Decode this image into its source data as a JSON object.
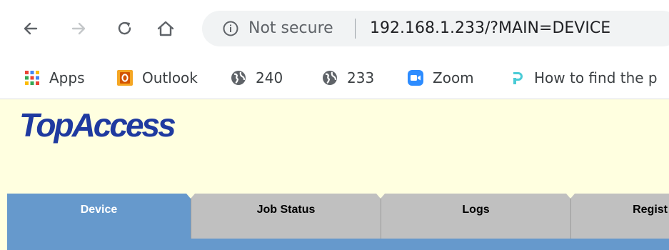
{
  "browser": {
    "security_label": "Not secure",
    "url": "192.168.1.233/?MAIN=DEVICE"
  },
  "bookmarks": [
    {
      "label": "Apps",
      "icon": "apps-grid-icon"
    },
    {
      "label": "Outlook",
      "icon": "outlook-icon"
    },
    {
      "label": "240",
      "icon": "globe-icon"
    },
    {
      "label": "233",
      "icon": "globe-icon"
    },
    {
      "label": "Zoom",
      "icon": "zoom-icon"
    },
    {
      "label": "How to find the p",
      "icon": "tplink-icon"
    }
  ],
  "app": {
    "logo_text": "TopAccess",
    "tabs": [
      {
        "label": "Device",
        "active": true
      },
      {
        "label": "Job Status",
        "active": false
      },
      {
        "label": "Logs",
        "active": false
      },
      {
        "label": "Regist",
        "active": false
      }
    ]
  },
  "colors": {
    "page_background": "#ffffe0",
    "active_tab": "#6699cc",
    "inactive_tab": "#c0c0c0",
    "logo": "#1f3aa0"
  }
}
